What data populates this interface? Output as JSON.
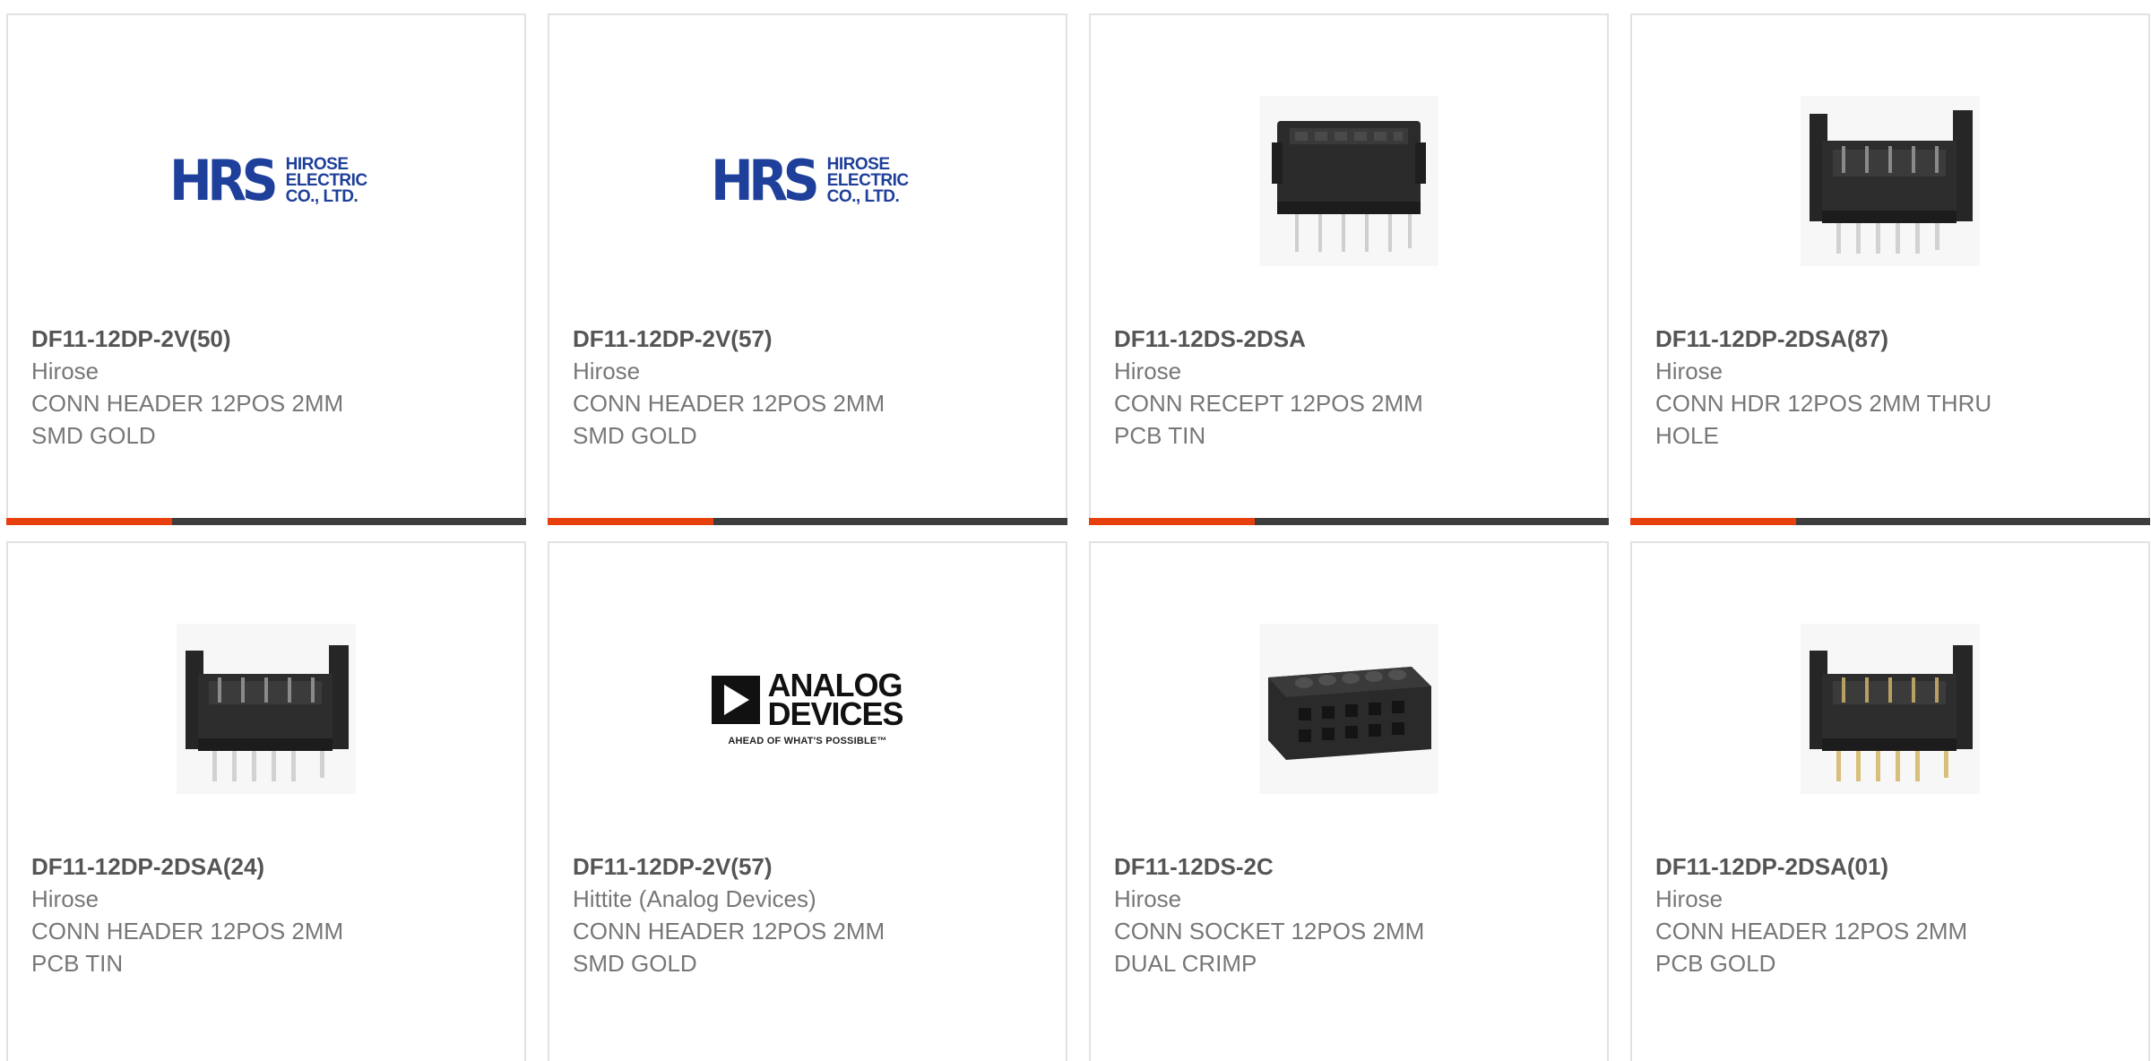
{
  "colors": {
    "accent": "#e8400c",
    "bar_dark": "#3d3d3d",
    "hrs_blue": "#1e3f9a",
    "part_number_text": "#555555",
    "body_text": "#777777"
  },
  "products": [
    {
      "part_number": "DF11-12DP-2V(50)",
      "manufacturer": "Hirose",
      "description": "CONN HEADER 12POS 2MM\nSMD GOLD",
      "image": "hirose-logo",
      "logo_text": [
        "HIROSE",
        "ELECTRIC",
        "CO., LTD."
      ],
      "logo_mark": "HRS"
    },
    {
      "part_number": "DF11-12DP-2V(57)",
      "manufacturer": "Hirose",
      "description": "CONN HEADER 12POS 2MM\nSMD GOLD",
      "image": "hirose-logo",
      "logo_text": [
        "HIROSE",
        "ELECTRIC",
        "CO., LTD."
      ],
      "logo_mark": "HRS"
    },
    {
      "part_number": "DF11-12DS-2DSA",
      "manufacturer": "Hirose",
      "description": "CONN RECEPT 12POS 2MM\nPCB TIN",
      "image": "receptacle-connector-photo"
    },
    {
      "part_number": "DF11-12DP-2DSA(87)",
      "manufacturer": "Hirose",
      "description": "CONN HDR 12POS 2MM THRU\nHOLE",
      "image": "header-connector-photo"
    },
    {
      "part_number": "DF11-12DP-2DSA(24)",
      "manufacturer": "Hirose",
      "description": "CONN HEADER 12POS 2MM\nPCB TIN",
      "image": "header-connector-photo"
    },
    {
      "part_number": "DF11-12DP-2V(57)",
      "manufacturer": "Hittite (Analog Devices)",
      "description": "CONN HEADER 12POS 2MM\nSMD GOLD",
      "image": "analog-devices-logo",
      "logo_words": [
        "ANALOG",
        "DEVICES"
      ],
      "logo_tagline": "AHEAD OF WHAT'S POSSIBLE™"
    },
    {
      "part_number": "DF11-12DS-2C",
      "manufacturer": "Hirose",
      "description": "CONN SOCKET 12POS 2MM\nDUAL CRIMP",
      "image": "crimp-socket-photo"
    },
    {
      "part_number": "DF11-12DP-2DSA(01)",
      "manufacturer": "Hirose",
      "description": "CONN HEADER 12POS 2MM\nPCB GOLD",
      "image": "gold-header-connector-photo"
    }
  ]
}
